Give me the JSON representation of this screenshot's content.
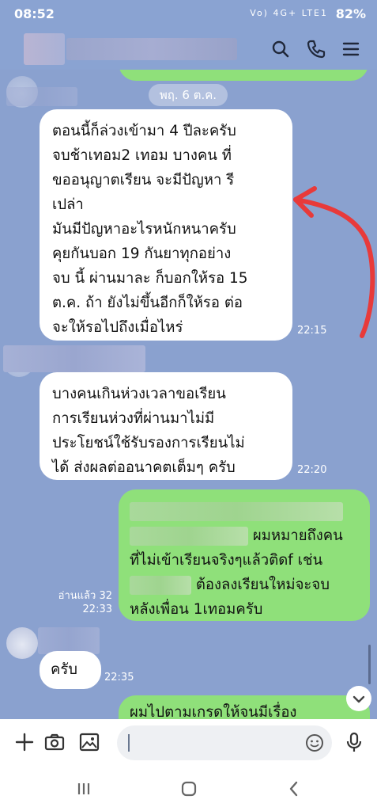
{
  "status_bar": {
    "time": "08:52",
    "network": "Vo) 4G+ LTE1",
    "battery": "82%"
  },
  "header": {
    "icons": [
      "search-icon",
      "phone-icon",
      "menu-icon"
    ]
  },
  "chat": {
    "date_label": "พฤ. 6 ต.ค.",
    "messages": [
      {
        "direction": "incoming",
        "text": "ตอนนี้ก็ล่วงเข้ามา 4 ปีละครับ\nจบช้าเทอม2 เทอม บางคน ที่\nขออนุญาตเรียน จะมีปัญหา รี\nเปล่า\nมันมีปัญหาอะไรหนักหนาครับ\nคุยกันบอก 19 กันยาทุกอย่าง\nจบ นี้ ผ่านมาละ ก็บอกให้รอ 15\nต.ค. ถ้า ยังไม่ขึ้นอีกก็ให้รอ ต่อ\nจะให้รอไปถึงเมื่อไหร่",
        "time": "22:15"
      },
      {
        "direction": "incoming",
        "text": "บางคนเกินห่วงเวลาขอเรียน\nการเรียนห่วงที่ผ่านมาไม่มี\nประโยชน์ใช้รับรองการเรียนไม่\nได้ ส่งผลต่ออนาคตเต็มๆ ครับ",
        "time": "22:20"
      },
      {
        "direction": "outgoing",
        "line1": "ผมหมายถึงคน",
        "line2": "ที่ไม่เข้าเรียนจริงๆแล้วติดf เช่น",
        "line3": "ต้องลงเรียนใหม่จะจบ",
        "line4": "หลังเพื่อน 1เทอมครับ",
        "read_label": "อ่านแล้ว 32",
        "time": "22:33"
      },
      {
        "direction": "incoming",
        "text": "ครับ",
        "time": "22:35"
      },
      {
        "direction": "outgoing",
        "text": "ผมไปตามเกรดให้จนมีเรื่อง"
      }
    ]
  },
  "input_bar": {
    "icons": [
      "plus-icon",
      "camera-icon",
      "image-icon",
      "emoji-icon",
      "mic-icon"
    ]
  },
  "nav_bar": {
    "icons": [
      "recents-icon",
      "home-icon",
      "back-icon"
    ]
  },
  "colors": {
    "chat_background": "#8aa1cf",
    "outgoing_bubble": "#8fe07a",
    "incoming_bubble": "#ffffff",
    "annotation_arrow": "#e83a3a"
  }
}
